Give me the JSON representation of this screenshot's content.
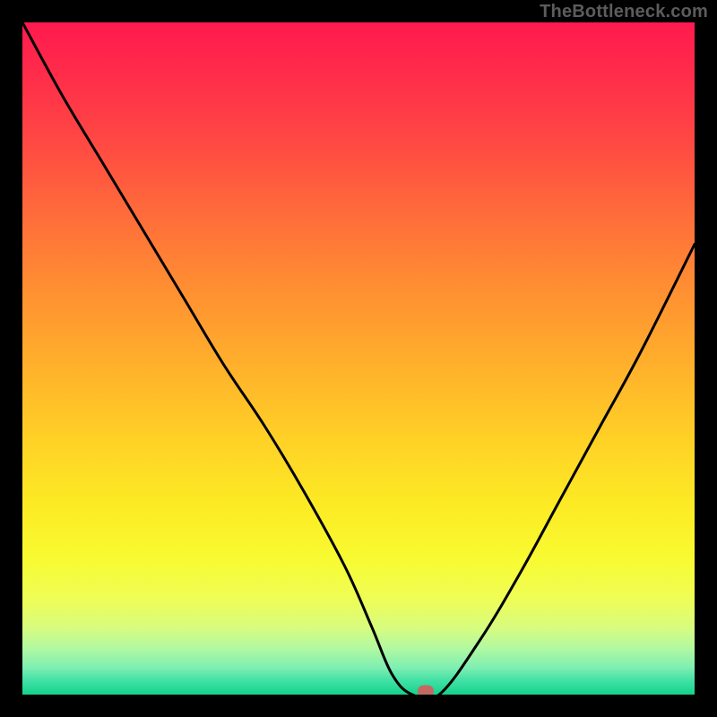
{
  "attribution": "TheBottleneck.com",
  "chart_data": {
    "type": "line",
    "title": "",
    "xlabel": "",
    "ylabel": "",
    "xlim": [
      0,
      100
    ],
    "ylim": [
      0,
      100
    ],
    "grid": false,
    "legend": false,
    "series": [
      {
        "name": "bottleneck-curve",
        "x": [
          0,
          6,
          12,
          18,
          24,
          30,
          36,
          42,
          48,
          52,
          55,
          58,
          62,
          68,
          74,
          80,
          86,
          92,
          100
        ],
        "values": [
          100,
          89,
          79,
          69,
          59,
          49,
          40,
          30,
          19,
          10,
          3,
          0,
          0,
          8,
          18,
          29,
          40,
          51,
          67
        ]
      }
    ],
    "marker": {
      "x": 60,
      "y": 0,
      "color": "#c26a62"
    },
    "colors": {
      "curve": "#000000",
      "frame": "#000000",
      "gradient_top": "#ff1a4f",
      "gradient_mid": "#ffd126",
      "gradient_bottom": "#14d28a"
    }
  }
}
